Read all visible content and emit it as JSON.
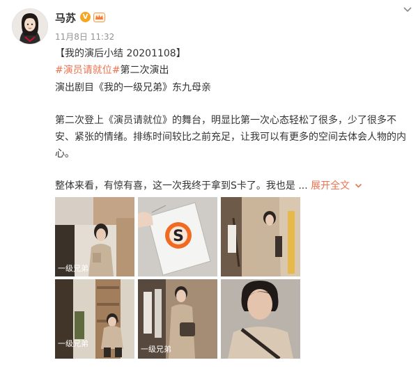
{
  "post": {
    "author": "马苏",
    "v_badge": "V",
    "time": "11月8日 11:32",
    "line1": "【我的演后小结 20201108】",
    "topic": "#演员请就位#",
    "line2_rest": "第二次演出",
    "line3": "演出剧目《我的一级兄弟》东九母亲",
    "para1_line1": "第二次登上《演员请就位》的舞台，明显比第一次心态轻松了很多，少了很多不",
    "para1_line2": "安、紧张的情绪。排练时间较比之前充足，让我可以有更多的空间去体会人物的内",
    "para1_line3": "心。",
    "para2": "整体来看，有惊有喜，这一次我终于拿到S卡了。我也是 ...",
    "expand_label": "展开全文",
    "card_letter": "S",
    "watermark": "一级兄弟"
  },
  "colors": {
    "accent": "#eb7350",
    "vip": "#f5a623",
    "meta": "#939393"
  },
  "icons": [
    "chevron-down-icon",
    "verified-v-icon",
    "vip-crown-icon",
    "expand-chevron-icon"
  ]
}
